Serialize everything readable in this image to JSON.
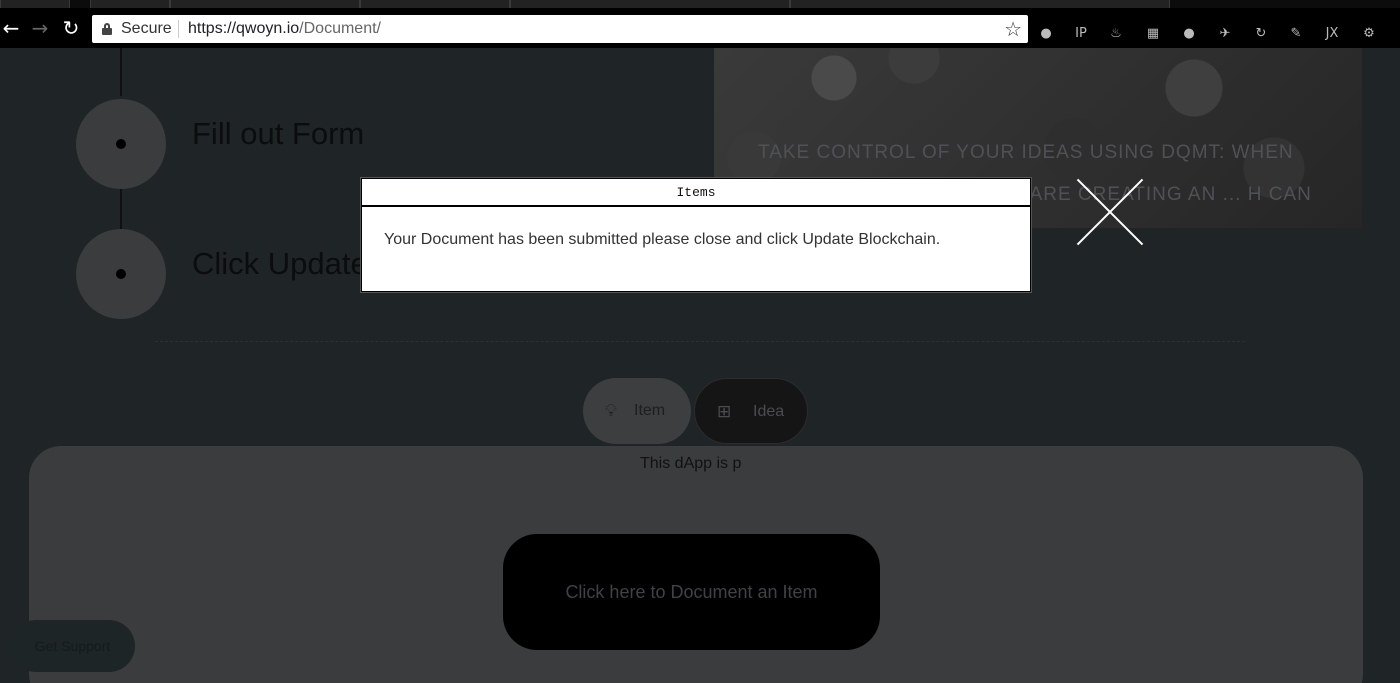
{
  "browser": {
    "secure_label": "Secure",
    "url_base": "https://qwoyn.io",
    "url_path": "/Document/",
    "icons": [
      "back-icon",
      "forward-icon",
      "reload-icon",
      "lock-icon",
      "star-icon"
    ]
  },
  "extensions": [
    "ext-1-icon",
    "ext-ip-icon",
    "ext-java-icon",
    "ext-keyboard-icon",
    "ext-circle-icon",
    "ext-plane-icon",
    "ext-sync-icon",
    "ext-tools-icon",
    "ext-jx-icon",
    "ext-settings-icon"
  ],
  "ext_glyphs": [
    "●",
    "IP",
    "♨",
    "▦",
    "●",
    "✈",
    "↻",
    "✎",
    "JX",
    "⚙"
  ],
  "hero": {
    "text": "TAKE CONTROL OF YOUR IDEAS USING DQMT: WHEN YOU USE DOCUMENT YOU ARE CREATING AN ... H CAN BE VIEWED BY"
  },
  "steps": [
    {
      "label": "Fill out Form"
    },
    {
      "label": "Click Update"
    }
  ],
  "tabs": {
    "item_label": "Item",
    "idea_label": "Idea"
  },
  "panel": {
    "text": "This dApp is p",
    "document_button": "Click here to Document an Item"
  },
  "support_label": "Get Support",
  "modal": {
    "title": "Items",
    "message": "Your Document has been submitted please close and click Update Blockchain."
  }
}
